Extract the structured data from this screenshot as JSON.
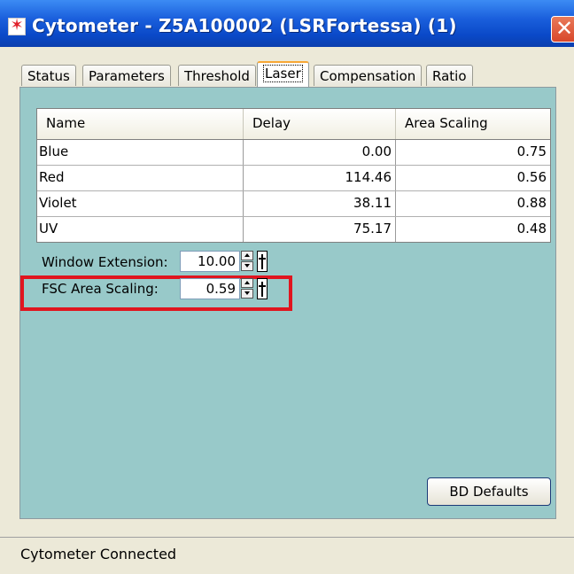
{
  "window": {
    "title": "Cytometer - Z5A100002 (LSRFortessa) (1)",
    "app_icon": "laser-star-icon",
    "close_icon": "close-icon"
  },
  "tabs": [
    {
      "label": "Status",
      "active": false
    },
    {
      "label": "Parameters",
      "active": false
    },
    {
      "label": "Threshold",
      "active": false
    },
    {
      "label": "Laser",
      "active": true
    },
    {
      "label": "Compensation",
      "active": false
    },
    {
      "label": "Ratio",
      "active": false
    }
  ],
  "laser_table": {
    "columns": [
      "Name",
      "Delay",
      "Area Scaling"
    ],
    "rows": [
      {
        "name": "Blue",
        "delay": "0.00",
        "area_scaling": "0.75"
      },
      {
        "name": "Red",
        "delay": "114.46",
        "area_scaling": "0.56"
      },
      {
        "name": "Violet",
        "delay": "38.11",
        "area_scaling": "0.88"
      },
      {
        "name": "UV",
        "delay": "75.17",
        "area_scaling": "0.48"
      }
    ]
  },
  "window_extension": {
    "label": "Window Extension:",
    "value": "10.00"
  },
  "fsc_area_scaling": {
    "label": "FSC Area Scaling:",
    "value": "0.59"
  },
  "bd_defaults_label": "BD Defaults",
  "status_text": "Cytometer Connected",
  "colors": {
    "panel_background": "#98c9c9",
    "highlight_border": "#e0151f",
    "titlebar": "#0a49c8"
  }
}
